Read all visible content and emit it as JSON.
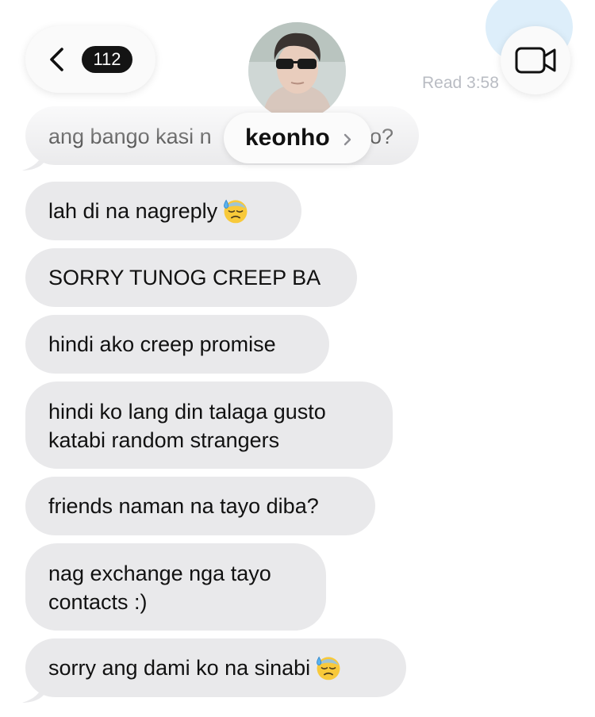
{
  "header": {
    "unread_count": "112",
    "contact_name": "keonho",
    "read_receipt": "Read 3:58"
  },
  "messages": [
    {
      "text": "ang bango kasi n",
      "text_end": "o?"
    },
    {
      "text": "lah di na nagreply",
      "emoji": "downcast-sweat-face"
    },
    {
      "text": "SORRY TUNOG CREEP BA"
    },
    {
      "text": "hindi ako creep promise"
    },
    {
      "line1": "hindi ko lang din talaga gusto",
      "line2": "katabi random strangers"
    },
    {
      "text": "friends naman na tayo diba?"
    },
    {
      "line1": "nag exchange nga tayo",
      "line2": "contacts :)"
    },
    {
      "text": "sorry ang dami ko na sinabi",
      "emoji": "downcast-sweat-face"
    }
  ],
  "colors": {
    "bubble_bg": "#e9e9eb",
    "background": "#ffffff",
    "badge_bg": "#141414",
    "read_text": "#b9bcc3"
  }
}
